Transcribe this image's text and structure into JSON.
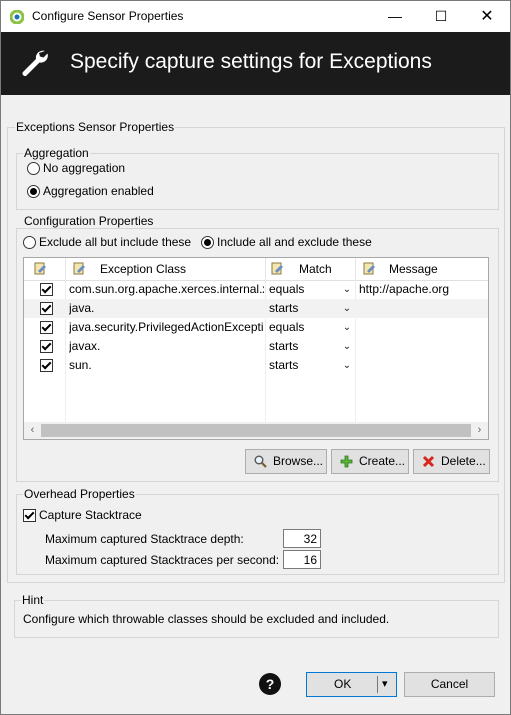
{
  "window": {
    "title": "Configure Sensor Properties",
    "minimize": "—",
    "maximize": "☐",
    "close": "✕"
  },
  "header": {
    "title": "Specify capture settings for Exceptions"
  },
  "exceptions_group": {
    "legend": "Exceptions Sensor Properties"
  },
  "aggregation": {
    "legend": "Aggregation",
    "options": [
      "No aggregation",
      "Aggregation enabled"
    ],
    "selected": "Aggregation enabled"
  },
  "configuration": {
    "legend": "Configuration Properties",
    "modes": [
      "Exclude all but include these",
      "Include all and exclude these"
    ],
    "selected_mode": "Include all and exclude these",
    "columns": [
      "Exception Class",
      "Match",
      "Message"
    ],
    "rows": [
      {
        "checked": true,
        "exception_class": "com.sun.org.apache.xerces.internal.xr",
        "match": "equals",
        "message": "http://apache.org"
      },
      {
        "checked": true,
        "exception_class": "java.",
        "match": "starts",
        "message": ""
      },
      {
        "checked": true,
        "exception_class": "java.security.PrivilegedActionExceptic",
        "match": "equals",
        "message": ""
      },
      {
        "checked": true,
        "exception_class": "javax.",
        "match": "starts",
        "message": ""
      },
      {
        "checked": true,
        "exception_class": "sun.",
        "match": "starts",
        "message": ""
      }
    ],
    "buttons": {
      "browse": "Browse...",
      "create": "Create...",
      "delete": "Delete..."
    }
  },
  "overhead": {
    "legend": "Overhead Properties",
    "capture_stacktrace_label": "Capture Stacktrace",
    "capture_stacktrace_checked": true,
    "depth_label": "Maximum captured Stacktrace depth:",
    "depth_value": "32",
    "per_second_label": "Maximum captured Stacktraces per second:",
    "per_second_value": "16"
  },
  "hint": {
    "legend": "Hint",
    "text": "Configure which throwable classes should be excluded and included."
  },
  "footer": {
    "help": "?",
    "ok": "OK",
    "ok_dropdown": "▾",
    "cancel": "Cancel"
  },
  "icons": {
    "wrench": "wrench-icon",
    "browse": "magnifier-icon",
    "create": "plus-icon",
    "delete": "delete-x-icon",
    "column": "column-edit-icon"
  }
}
